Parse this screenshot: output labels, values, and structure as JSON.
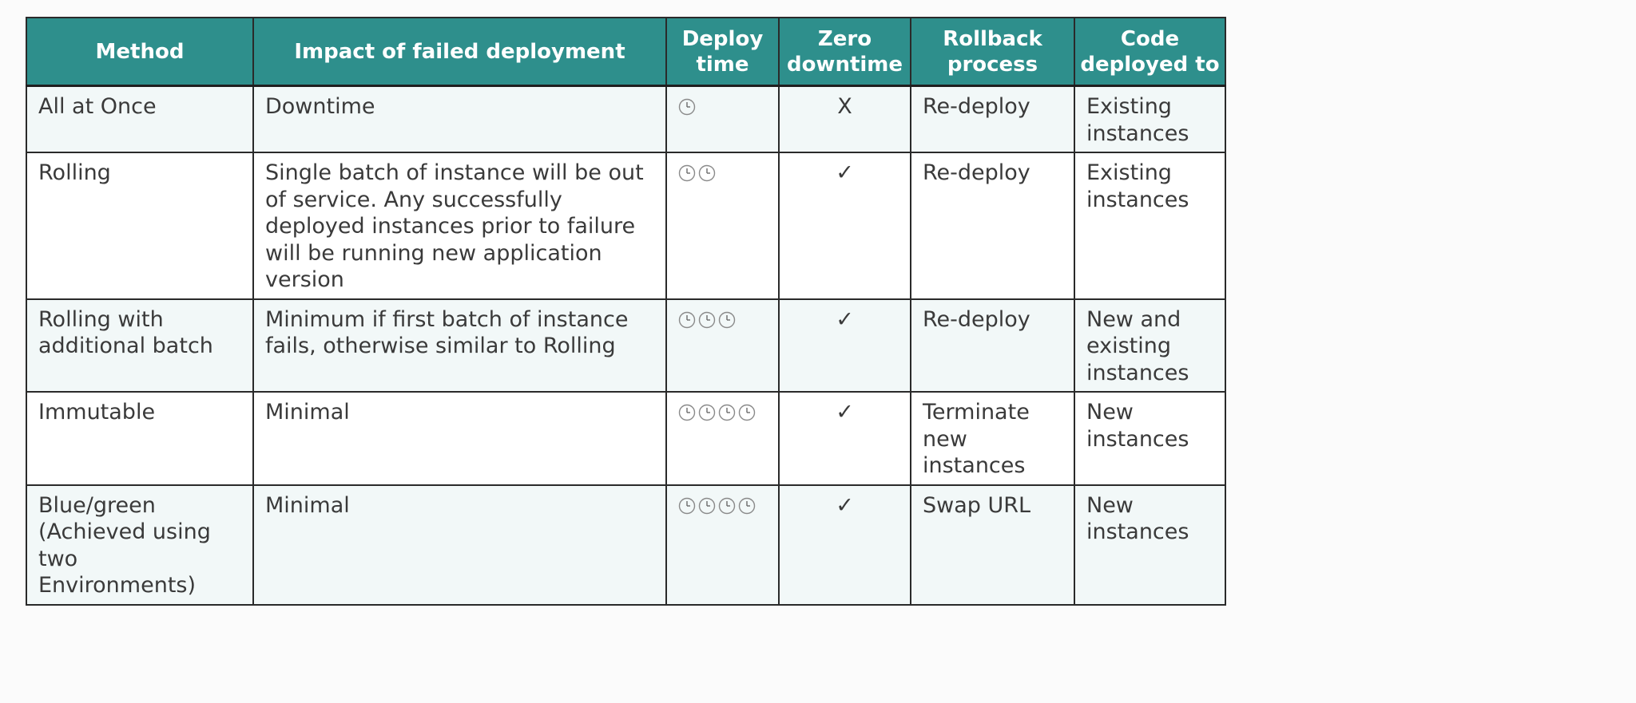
{
  "table": {
    "headers": [
      "Method",
      "Impact of failed deployment",
      "Deploy time",
      "Zero downtime",
      "Rollback process",
      "Code deployed to"
    ],
    "header_color": "#2E8F8C",
    "rows": [
      {
        "method": "All at Once",
        "impact": "Downtime",
        "deploy_time_clocks": 1,
        "deploy_time_icon": "clock-icon",
        "zero_downtime": "X",
        "rollback": "Re-deploy",
        "deployed_to": "Existing instances"
      },
      {
        "method": "Rolling",
        "impact": "Single batch of instance will be out of service. Any successfully deployed instances prior to failure will be running new application version",
        "deploy_time_clocks": 2,
        "deploy_time_icon": "clock-icon",
        "zero_downtime": "✓",
        "rollback": "Re-deploy",
        "deployed_to": "Existing instances"
      },
      {
        "method": "Rolling with additional batch",
        "impact": "Minimum if first batch of instance fails, otherwise similar to Rolling",
        "deploy_time_clocks": 3,
        "deploy_time_icon": "clock-icon",
        "zero_downtime": "✓",
        "rollback": "Re-deploy",
        "deployed_to": "New and existing instances"
      },
      {
        "method": "Immutable",
        "impact": "Minimal",
        "deploy_time_clocks": 4,
        "deploy_time_icon": "clock-icon",
        "zero_downtime": "✓",
        "rollback": "Terminate new instances",
        "deployed_to": "New instances"
      },
      {
        "method": "Blue/green (Achieved using two Environments)",
        "impact": "Minimal",
        "deploy_time_clocks": 4,
        "deploy_time_icon": "clock-icon",
        "zero_downtime": "✓",
        "rollback": "Swap URL",
        "deployed_to": "New instances"
      }
    ]
  }
}
